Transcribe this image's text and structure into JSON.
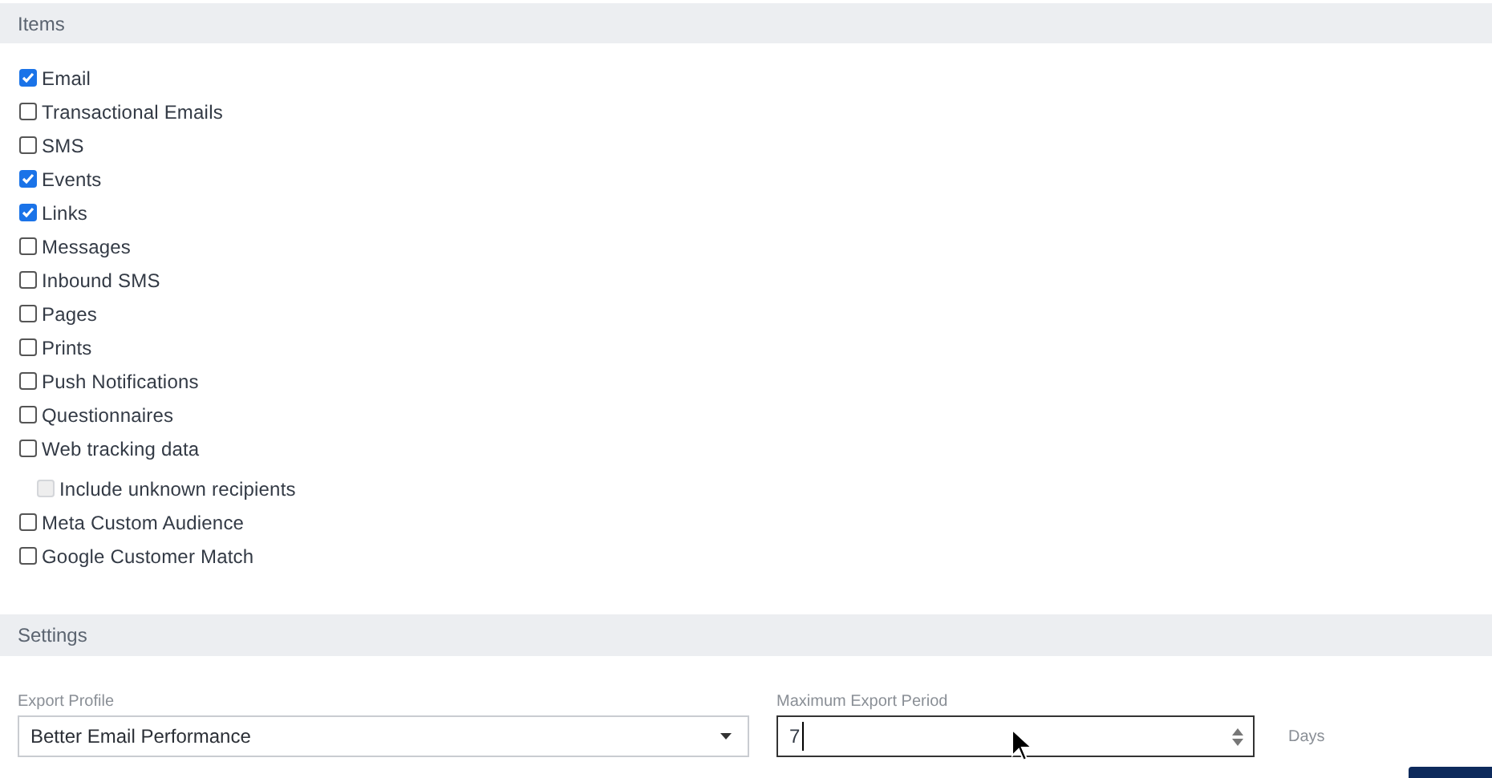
{
  "items_section": {
    "title": "Items",
    "items": [
      {
        "label": "Email",
        "checked": true,
        "disabled": false
      },
      {
        "label": "Transactional Emails",
        "checked": false,
        "disabled": false
      },
      {
        "label": "SMS",
        "checked": false,
        "disabled": false
      },
      {
        "label": "Events",
        "checked": true,
        "disabled": false
      },
      {
        "label": "Links",
        "checked": true,
        "disabled": false
      },
      {
        "label": "Messages",
        "checked": false,
        "disabled": false
      },
      {
        "label": "Inbound SMS",
        "checked": false,
        "disabled": false
      },
      {
        "label": "Pages",
        "checked": false,
        "disabled": false
      },
      {
        "label": "Prints",
        "checked": false,
        "disabled": false
      },
      {
        "label": "Push Notifications",
        "checked": false,
        "disabled": false
      },
      {
        "label": "Questionnaires",
        "checked": false,
        "disabled": false
      },
      {
        "label": "Web tracking data",
        "checked": false,
        "disabled": false,
        "children": [
          {
            "label": "Include unknown recipients",
            "checked": false,
            "disabled": true
          }
        ]
      },
      {
        "label": "Meta Custom Audience",
        "checked": false,
        "disabled": false
      },
      {
        "label": "Google Customer Match",
        "checked": false,
        "disabled": false
      }
    ]
  },
  "settings": {
    "title": "Settings",
    "export_profile": {
      "label": "Export Profile",
      "value": "Better Email Performance"
    },
    "max_export_period": {
      "label": "Maximum Export Period",
      "value": "7",
      "unit": "Days"
    }
  }
}
